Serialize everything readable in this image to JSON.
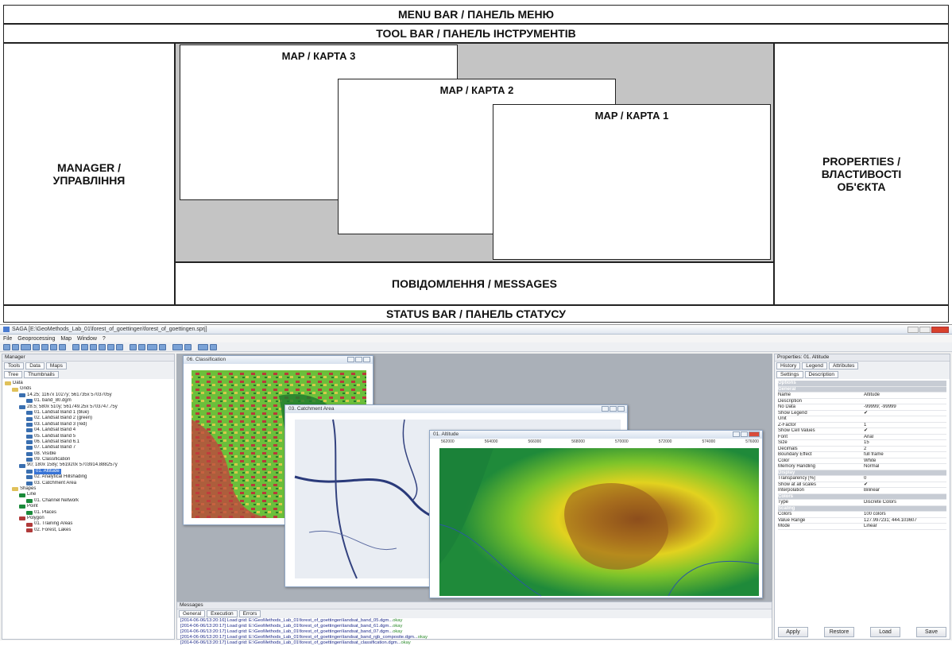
{
  "diagram": {
    "menu_bar": "MENU BAR / ПАНЕЛЬ МЕНЮ",
    "tool_bar": "TOOL BAR / ПАНЕЛЬ ІНСТРУМЕНТІВ",
    "manager": "MANAGER / УПРАВЛІННЯ",
    "properties": "PROPERTIES / ВЛАСТИВОСТІ ОБ'ЄКТА",
    "map3": "MAP / КАРТА 3",
    "map2": "MAP / КАРТА 2",
    "map1": "MAP / КАРТА 1",
    "messages": "ПОВІДОМЛЕННЯ / MESSAGES",
    "status_bar": "STATUS BAR / ПАНЕЛЬ СТАТУСУ",
    "colors": {
      "workspace": "#c4c4c4",
      "border": "#222222"
    }
  },
  "app": {
    "title": "SAGA [E:\\GeoMethods_Lab_01\\forest_of_goettingen\\forest_of_goettingen.sprj]",
    "menu": [
      "File",
      "Geoprocessing",
      "Map",
      "Window",
      "?"
    ],
    "manager": {
      "header": "Manager",
      "tabs": [
        "Tools",
        "Data",
        "Maps"
      ],
      "subtabs": [
        "Tree",
        "Thumbnails"
      ],
      "tree": [
        {
          "label": "Data",
          "icon": "folder",
          "lvl": 0
        },
        {
          "label": "Grids",
          "icon": "folder",
          "lvl": 1
        },
        {
          "label": "14.25; 1167x 1027y; 561735x 5703705y",
          "icon": "grid",
          "lvl": 2
        },
        {
          "label": "01. band_80.dgm",
          "icon": "grid",
          "lvl": 3
        },
        {
          "label": "28.5; 580x 510y; 561749.25x 5703747.75y",
          "icon": "grid",
          "lvl": 2
        },
        {
          "label": "01. Landsat Band 1 (blue)",
          "icon": "grid",
          "lvl": 3
        },
        {
          "label": "02. Landsat Band 2 (green)",
          "icon": "grid",
          "lvl": 3
        },
        {
          "label": "03. Landsat Band 3 (red)",
          "icon": "grid",
          "lvl": 3
        },
        {
          "label": "04. Landsat Band 4",
          "icon": "grid",
          "lvl": 3
        },
        {
          "label": "05. Landsat Band 5",
          "icon": "grid",
          "lvl": 3
        },
        {
          "label": "06. Landsat Band 6.1",
          "icon": "grid",
          "lvl": 3
        },
        {
          "label": "07. Landsat Band 7",
          "icon": "grid",
          "lvl": 3
        },
        {
          "label": "08. Visible",
          "icon": "grid",
          "lvl": 3
        },
        {
          "label": "09. Classification",
          "icon": "grid",
          "lvl": 3
        },
        {
          "label": "90; 180x 158y; 561920x 5703914.888257y",
          "icon": "grid",
          "lvl": 2
        },
        {
          "label": "01. Altitude",
          "icon": "grid",
          "lvl": 3,
          "selected": true
        },
        {
          "label": "02. Analytical Hillshading",
          "icon": "grid",
          "lvl": 3
        },
        {
          "label": "03. Catchment Area",
          "icon": "grid",
          "lvl": 3
        },
        {
          "label": "Shapes",
          "icon": "folder",
          "lvl": 1
        },
        {
          "label": "Line",
          "icon": "line",
          "lvl": 2
        },
        {
          "label": "01. Channel Network",
          "icon": "line",
          "lvl": 3
        },
        {
          "label": "Point",
          "icon": "line",
          "lvl": 2
        },
        {
          "label": "01. Places",
          "icon": "line",
          "lvl": 3
        },
        {
          "label": "Polygon",
          "icon": "poly",
          "lvl": 2
        },
        {
          "label": "01. Training Areas",
          "icon": "poly",
          "lvl": 3
        },
        {
          "label": "02. Forest, Lakes",
          "icon": "poly",
          "lvl": 3
        }
      ]
    },
    "windows": {
      "classification": "06. Classification",
      "catchment": "03. Catchment Area",
      "altitude": "01. Altitude",
      "xticks": [
        "562000",
        "564000",
        "566000",
        "568000",
        "570000",
        "572000",
        "574000",
        "576000"
      ]
    },
    "properties": {
      "header": "Properties: 01. Altitude",
      "tabs": [
        "History",
        "Legend",
        "Attributes"
      ],
      "subtabs": [
        "Settings",
        "Description"
      ],
      "rows": [
        {
          "k": "Options",
          "v": "",
          "sec": true
        },
        {
          "k": "General",
          "v": "",
          "sec": true
        },
        {
          "k": "Name",
          "v": "Altitude"
        },
        {
          "k": "Description",
          "v": ""
        },
        {
          "k": "No Data",
          "v": "-99999; -99999"
        },
        {
          "k": "Show Legend",
          "v": "✔"
        },
        {
          "k": "Unit",
          "v": ""
        },
        {
          "k": "Z-Factor",
          "v": "1"
        },
        {
          "k": "Show Cell Values",
          "v": "✔"
        },
        {
          "k": "Font",
          "v": "Arial"
        },
        {
          "k": "Size",
          "v": "15"
        },
        {
          "k": "Decimals",
          "v": "2"
        },
        {
          "k": "Boundary Effect",
          "v": "full frame"
        },
        {
          "k": "Color",
          "v": "White"
        },
        {
          "k": "Memory Handling",
          "v": "Normal"
        },
        {
          "k": "Display",
          "v": "",
          "sec": true
        },
        {
          "k": "Transparency [%]",
          "v": "0"
        },
        {
          "k": "Show at all scales",
          "v": "✔"
        },
        {
          "k": "Interpolation",
          "v": "Bilinear"
        },
        {
          "k": "Colors",
          "v": "",
          "sec": true
        },
        {
          "k": "Type",
          "v": "Discrete Colors"
        },
        {
          "k": "Scaling",
          "v": "",
          "sec": true
        },
        {
          "k": "Colors",
          "v": "100 colors"
        },
        {
          "k": "Value Range",
          "v": "127.997231; 444.103607"
        },
        {
          "k": "Mode",
          "v": "Linear"
        }
      ],
      "buttons": [
        "Apply",
        "Restore",
        "Load",
        "Save"
      ]
    },
    "messages": {
      "header": "Messages",
      "tabs": [
        "General",
        "Execution",
        "Errors"
      ],
      "lines": [
        {
          "t": "[2014-06-06/13:20:16] Load grid: E:\\GeoMethods_Lab_01\\forest_of_goettingen\\landsat_band_05.dgm...",
          "s": "okay"
        },
        {
          "t": "[2014-06-06/13:20:17] Load grid: E:\\GeoMethods_Lab_01\\forest_of_goettingen\\landsat_band_61.dgm...",
          "s": "okay"
        },
        {
          "t": "[2014-06-06/13:20:17] Load grid: E:\\GeoMethods_Lab_01\\forest_of_goettingen\\landsat_band_07.dgm...",
          "s": "okay"
        },
        {
          "t": "[2014-06-06/13:20:17] Load grid: E:\\GeoMethods_Lab_01\\forest_of_goettingen\\landsat_band_rgb_composite.dgm...",
          "s": "okay"
        },
        {
          "t": "[2014-06-06/13:20:17] Load grid: E:\\GeoMethods_Lab_01\\forest_of_goettingen\\landsat_classification.dgm...",
          "s": "okay"
        }
      ]
    }
  }
}
